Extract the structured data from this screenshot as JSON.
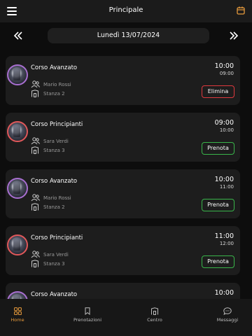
{
  "header": {
    "title": "Principale",
    "menu_icon": "hamburger-menu-icon",
    "calendar_icon": "calendar-icon"
  },
  "date_nav": {
    "date_label": "Lunedì 13/07/2024",
    "prev_icon": "double-chevron-left-icon",
    "next_icon": "double-chevron-right-icon"
  },
  "lessons": [
    {
      "course": "Corso Avanzato",
      "start": "10:00",
      "end": "09:00",
      "teacher": "Mario Rossi",
      "room": "Stanza 2",
      "action": "Elimina",
      "action_type": "danger",
      "avatar_ring": "#a86fd0"
    },
    {
      "course": "Corso Principianti",
      "start": "09:00",
      "end": "10:00",
      "teacher": "Sara Verdi",
      "room": "Stanza 3",
      "action": "Prenota",
      "action_type": "primary",
      "avatar_ring": "#e0585a"
    },
    {
      "course": "Corso Avanzato",
      "start": "10:00",
      "end": "11:00",
      "teacher": "Mario Rossi",
      "room": "Stanza 2",
      "action": "Prenota",
      "action_type": "primary",
      "avatar_ring": "#a86fd0"
    },
    {
      "course": "Corso Principianti",
      "start": "11:00",
      "end": "12:00",
      "teacher": "Sara Verdi",
      "room": "Stanza 3",
      "action": "Prenota",
      "action_type": "primary",
      "avatar_ring": "#e0585a"
    },
    {
      "course": "Corso Avanzato",
      "start": "10:00",
      "end": "",
      "teacher": "",
      "room": "",
      "action": "",
      "action_type": "",
      "avatar_ring": "#a86fd0"
    }
  ],
  "bottom_nav": {
    "items": [
      {
        "label": "Home",
        "icon": "home-grid-icon",
        "active": true
      },
      {
        "label": "Prenotazioni",
        "icon": "bookmark-icon",
        "active": false
      },
      {
        "label": "Centro",
        "icon": "building-icon",
        "active": false
      },
      {
        "label": "Messaggi",
        "icon": "chat-bubble-icon",
        "active": false
      }
    ]
  },
  "colors": {
    "accent": "#e89b3c",
    "primary_button": "#39b54a",
    "danger_button": "#e0393e",
    "card": "#1d1d1d",
    "background": "#0d0d0d"
  }
}
